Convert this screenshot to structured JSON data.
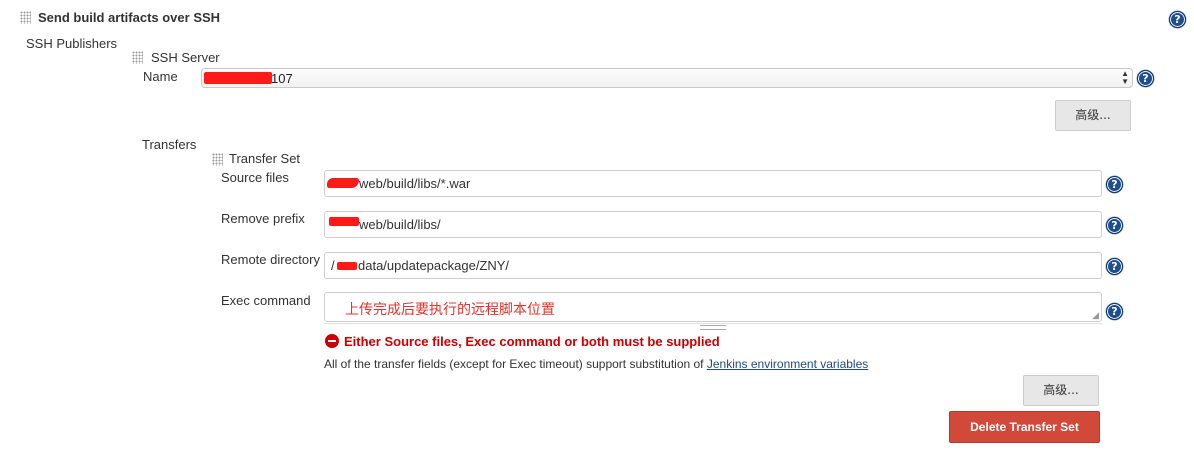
{
  "section": {
    "title": "Send build artifacts over SSH",
    "publishers_label": "SSH Publishers"
  },
  "ssh_server": {
    "heading": "SSH Server",
    "name_label": "Name",
    "name_value_suffix": "107",
    "advanced_label": "高级..."
  },
  "transfers": {
    "label": "Transfers",
    "set_heading": "Transfer Set",
    "source_files_label": "Source files",
    "source_files_value": "web/build/libs/*.war",
    "remove_prefix_label": "Remove prefix",
    "remove_prefix_value": "web/build/libs/",
    "remote_directory_label": "Remote directory",
    "remote_directory_prefix": "/",
    "remote_directory_value": "data/updatepackage/ZNY/",
    "exec_command_label": "Exec command",
    "exec_command_annotation": "上传完成后要执行的远程脚本位置",
    "error_text": "Either Source files, Exec command or both must be supplied",
    "info_text": "All of the transfer fields (except for Exec timeout) support substitution of",
    "info_link": "Jenkins environment variables",
    "advanced_label": "高级...",
    "delete_label": "Delete Transfer Set"
  },
  "help_glyph": "?",
  "colors": {
    "error_red": "#cc0000",
    "annotation_red": "#e8312a",
    "link_blue": "#204a87",
    "delete_button": "#d24939",
    "help_icon": "#1d4f8f"
  }
}
